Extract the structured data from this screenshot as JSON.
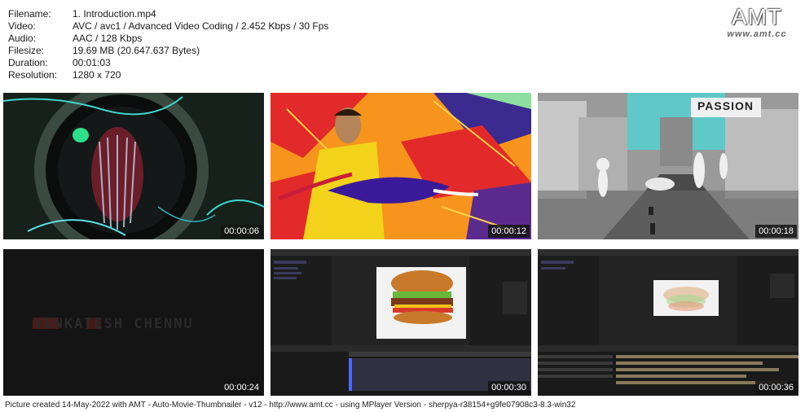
{
  "info": {
    "rows": [
      {
        "label": "Filename:",
        "value": "1. Introduction.mp4"
      },
      {
        "label": "Video:",
        "value": "AVC / avc1 / Advanced Video Coding / 2.452 Kbps / 30 Fps"
      },
      {
        "label": "Audio:",
        "value": "AAC / 128 Kbps"
      },
      {
        "label": "Filesize:",
        "value": "19.69 MB (20.647.637 Bytes)"
      },
      {
        "label": "Duration:",
        "value": "00:01:03"
      },
      {
        "label": "Resolution:",
        "value": "1280 x 720"
      }
    ]
  },
  "logo": {
    "text": "AMT",
    "url": "www.amt.cc"
  },
  "thumbnails": [
    {
      "timestamp": "00:00:06"
    },
    {
      "timestamp": "00:00:12"
    },
    {
      "timestamp": "00:00:18",
      "caption": "PASSION"
    },
    {
      "timestamp": "00:00:24",
      "caption": "VENKATESH CHENNU"
    },
    {
      "timestamp": "00:00:30"
    },
    {
      "timestamp": "00:00:36"
    }
  ],
  "footer": "Picture created 14-May-2022 with AMT - Auto-Movie-Thumbnailer - v12 - http://www.amt.cc - using MPlayer Version - sherpya-r38154+g9fe07908c3-8.3-win32",
  "colors": {
    "background": "#ffffff",
    "timestamp_bg": "#141414",
    "ae_panel": "#1e1e1e"
  }
}
